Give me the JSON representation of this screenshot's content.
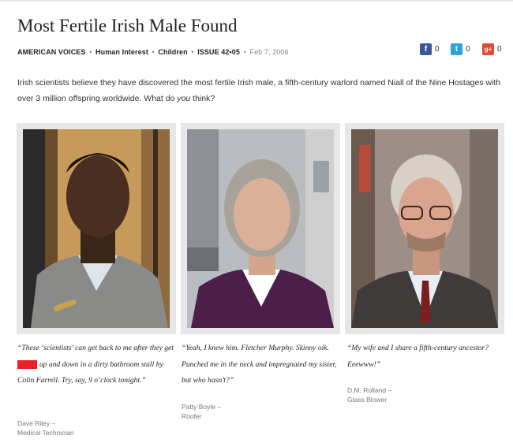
{
  "article": {
    "title": "Most Fertile Irish Male Found",
    "meta": {
      "section": "AMERICAN VOICES",
      "tag1": "Human Interest",
      "tag2": "Children",
      "issue": "ISSUE 42•05",
      "date": "Feb 7, 2006",
      "separator": "•"
    },
    "intro_part1": "Irish scientists believe they have discovered the most fertile Irish male, a fifth-century warlord named Niall of the Nine Hostages with over 3 million offspring worldwide. What do ",
    "intro_em": "you",
    "intro_part2": " think?"
  },
  "share": {
    "facebook": {
      "icon": "facebook-icon",
      "glyph": "f",
      "count": "0",
      "color": "#3b5998"
    },
    "twitter": {
      "icon": "twitter-icon",
      "glyph": "t",
      "count": "0",
      "color": "#2aa4dc"
    },
    "googleplus": {
      "icon": "google-plus-icon",
      "glyph": "g+",
      "count": "0",
      "color": "#dd4b39"
    }
  },
  "responses": [
    {
      "quote_part1": "“These ‘scientists’ can get back to me after they get ",
      "quote_redacted": "f-----d",
      "quote_part2": " up and down in a dirty bathroom stall by Colin Farrell. Try, say, 9 o’clock tonight.”",
      "name": "Dave Riley –",
      "occupation": "Medical Technician"
    },
    {
      "quote": "“Yeah, I knew him. Fletcher Murphy. Skinny oik. Punched me in the neck and impregnated my sister, but who hasn’t?”",
      "name": "Patty Boyle –",
      "occupation": "Roofer"
    },
    {
      "quote": "“My wife and I share a fifth-century ancestor? Eeewww!”",
      "name": "D.M. Rolland –",
      "occupation": "Glass Blower"
    }
  ],
  "colors": {
    "redaction": "#e8202a",
    "card_bg": "#e7e7e7"
  }
}
